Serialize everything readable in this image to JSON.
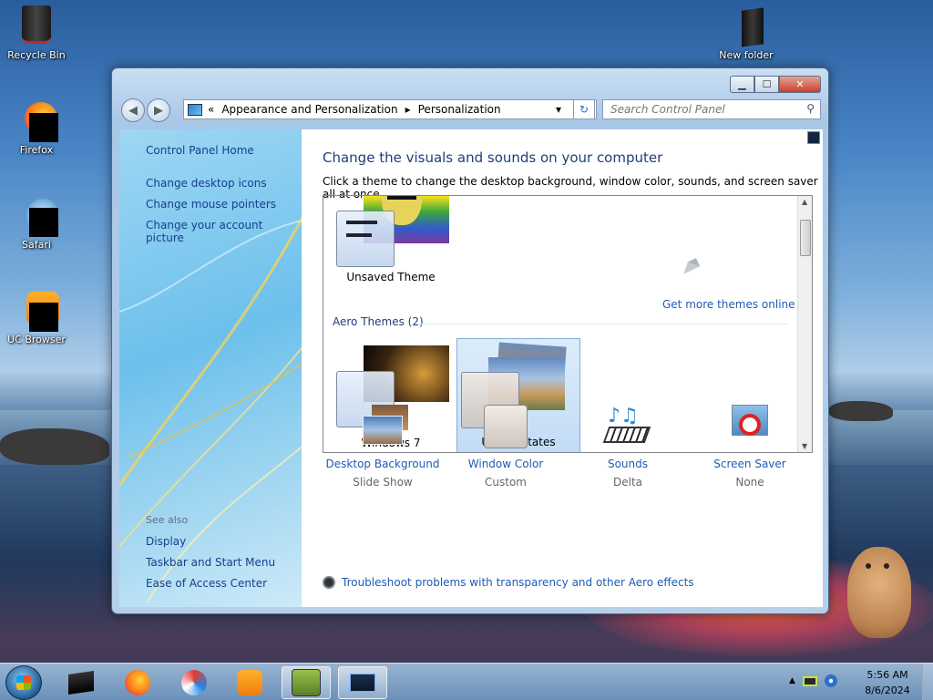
{
  "desktop": {
    "icons": [
      {
        "label": "Recycle Bin"
      },
      {
        "label": "Firefox"
      },
      {
        "label": "Safari"
      },
      {
        "label": "UC Browser"
      },
      {
        "label": "New folder"
      }
    ]
  },
  "window": {
    "caption": {
      "minimize": "▁",
      "maximize": "☐",
      "close": "✕"
    },
    "nav": {
      "back": "◀",
      "forward": "▶",
      "address_prefix": "«",
      "breadcrumb": [
        "Appearance and Personalization",
        "Personalization"
      ],
      "dropdown": "▾",
      "refresh": "↻",
      "search_placeholder": "Search Control Panel"
    },
    "sidebar": {
      "home": "Control Panel Home",
      "links": [
        "Change desktop icons",
        "Change mouse pointers",
        "Change your account picture"
      ],
      "see_also_title": "See also",
      "see_also": [
        "Display",
        "Taskbar and Start Menu",
        "Ease of Access Center"
      ]
    },
    "main": {
      "title": "Change the visuals and sounds on your computer",
      "subtitle": "Click a theme to change the desktop background, window color, sounds, and screen saver all at once.",
      "unsaved_theme": "Unsaved Theme",
      "get_more": "Get more themes online",
      "aero_group": "Aero Themes (2)",
      "aero_themes": [
        {
          "name": "Windows 7",
          "selected": false
        },
        {
          "name": "United States",
          "selected": true
        }
      ],
      "settings": [
        {
          "label": "Desktop Background",
          "value": "Slide Show"
        },
        {
          "label": "Window Color",
          "value": "Custom"
        },
        {
          "label": "Sounds",
          "value": "Delta"
        },
        {
          "label": "Screen Saver",
          "value": "None"
        }
      ],
      "troubleshoot": "Troubleshoot problems with transparency and other Aero effects"
    }
  },
  "taskbar": {
    "apps": [
      "Terminal",
      "Firefox",
      "Safari",
      "UC Browser",
      "Box",
      "Control Panel"
    ],
    "tray": {
      "up_arrow": "▲"
    },
    "clock": {
      "time": "5:56 AM",
      "date": "8/6/2024"
    }
  }
}
